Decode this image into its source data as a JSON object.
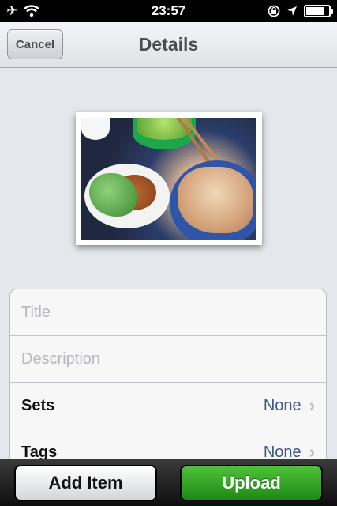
{
  "status_bar": {
    "time": "23:57",
    "airplane_icon": "airplane-icon",
    "wifi_icon": "wifi-icon",
    "orientation_lock_icon": "orientation-lock-icon",
    "location_icon": "location-icon",
    "battery_icon": "battery-icon",
    "battery_level": 0.8
  },
  "nav": {
    "title": "Details",
    "cancel_label": "Cancel"
  },
  "form": {
    "title_placeholder": "Title",
    "description_placeholder": "Description",
    "sets_label": "Sets",
    "sets_value": "None",
    "tags_label": "Tags",
    "tags_value": "None"
  },
  "toolbar": {
    "add_item_label": "Add Item",
    "upload_label": "Upload"
  },
  "colors": {
    "upload_green": "#2f9e24",
    "value_blue": "#3d5581",
    "nav_bg": "#e6e8ec"
  }
}
